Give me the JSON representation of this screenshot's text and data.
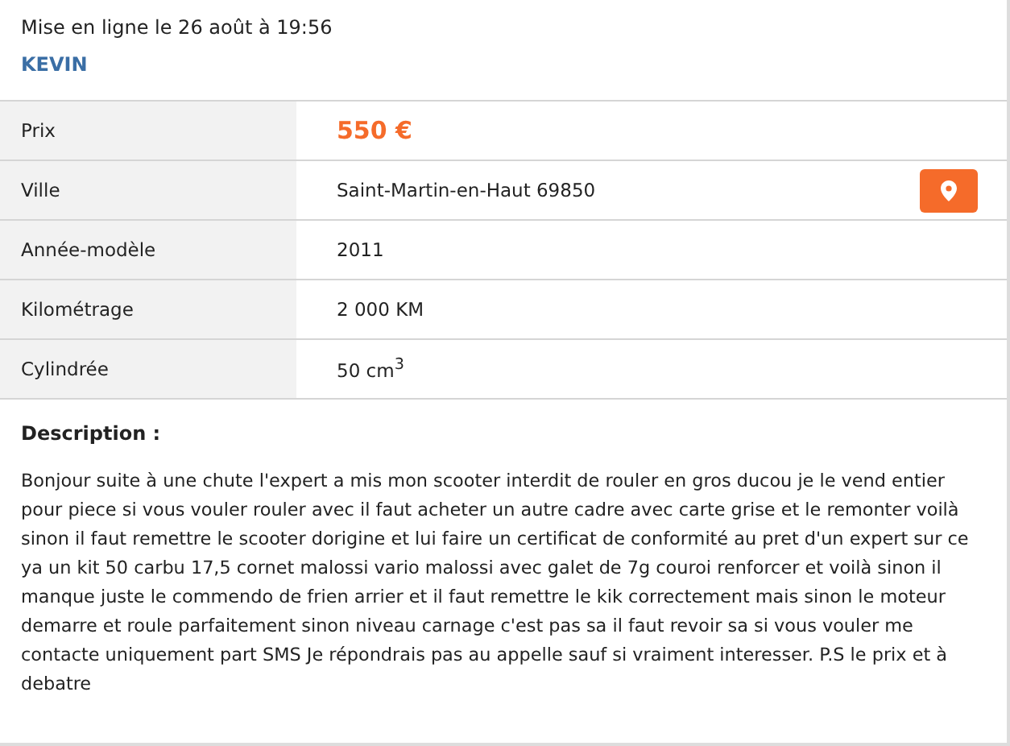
{
  "header": {
    "posted": "Mise en ligne le 26 août à 19:56",
    "seller": "KEVIN"
  },
  "details": [
    {
      "label": "Prix",
      "value": "550 €",
      "kind": "price"
    },
    {
      "label": "Ville",
      "value": "Saint-Martin-en-Haut 69850",
      "kind": "location"
    },
    {
      "label": "Année-modèle",
      "value": "2011",
      "kind": "plain"
    },
    {
      "label": "Kilométrage",
      "value": "2 000 KM",
      "kind": "plain"
    },
    {
      "label": "Cylindrée",
      "value": "50 cm$^{3}$",
      "kind": "plain"
    }
  ],
  "description": {
    "title": "Description :",
    "text": "Bonjour suite à une chute l'expert a mis mon scooter interdit de rouler en gros ducou je le vend entier pour piece si vous vouler rouler avec il faut acheter un autre cadre avec carte grise et le remonter voilà sinon il faut remettre le scooter dorigine et lui faire un certificat de conformité au pret d'un expert sur ce ya un kit 50 carbu 17,5 cornet malossi vario malossi avec galet de 7g couroi renforcer et voilà sinon il manque juste le commendo de frien arrier et il faut remettre le kik correctement mais sinon le moteur demarre et roule parfaitement sinon niveau carnage c'est pas sa il faut revoir sa si vous vouler me contacte uniquement part SMS Je répondrais pas au appelle sauf si vraiment interesser. P.S le prix et à debatre"
  }
}
